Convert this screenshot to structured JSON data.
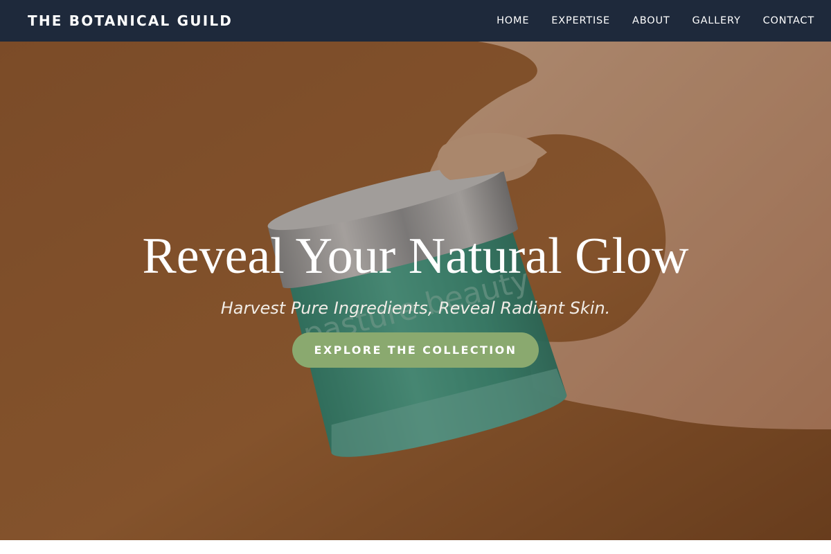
{
  "header": {
    "brand": "THE BOTANICAL GUILD",
    "nav": [
      "HOME",
      "EXPERTISE",
      "ABOUT",
      "GALLERY",
      "CONTACT"
    ]
  },
  "hero": {
    "title": "Reveal Your Natural Glow",
    "subtitle": "Harvest Pure Ingredients, Reveal Radiant Skin.",
    "cta_label": "EXPLORE THE COLLECTION",
    "jar_label": "pasture beauty",
    "image_description_icon": "hand-holding-jar-image"
  },
  "colors": {
    "navbar_bg": "#1e293b",
    "accent_button": "#8aa96f",
    "hero_background": "#9c5f30",
    "jar_teal": "#3fb5a0",
    "lid_silver": "#c9ccd0"
  }
}
